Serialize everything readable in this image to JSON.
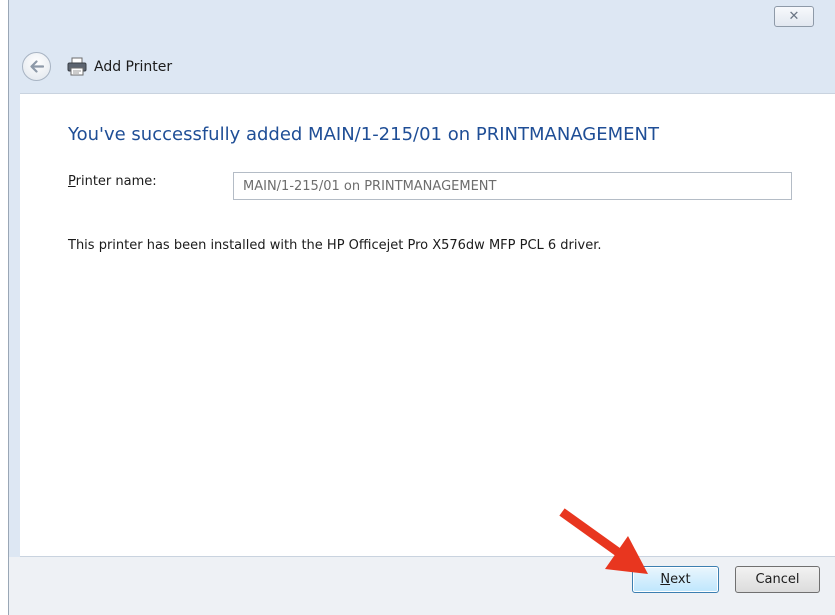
{
  "window": {
    "title": "Add Printer",
    "close_glyph": "✕"
  },
  "content": {
    "headline": "You've successfully added MAIN/1-215/01 on PRINTMANAGEMENT",
    "printer_name_label_mnemonic": "P",
    "printer_name_label_rest": "rinter name:",
    "printer_name_value": "MAIN/1-215/01 on PRINTMANAGEMENT",
    "driver_message": "This printer has been installed with the HP Officejet Pro X576dw MFP PCL 6 driver."
  },
  "footer": {
    "next_mnemonic": "N",
    "next_rest": "ext",
    "cancel_label": "Cancel"
  },
  "icons": {
    "back": "back-arrow-icon",
    "printer": "printer-icon",
    "annotation": "red-arrow-annotation"
  },
  "colors": {
    "headline": "#1f4e96",
    "annotation_arrow": "#e8361f",
    "next_border": "#3c7fb1"
  }
}
